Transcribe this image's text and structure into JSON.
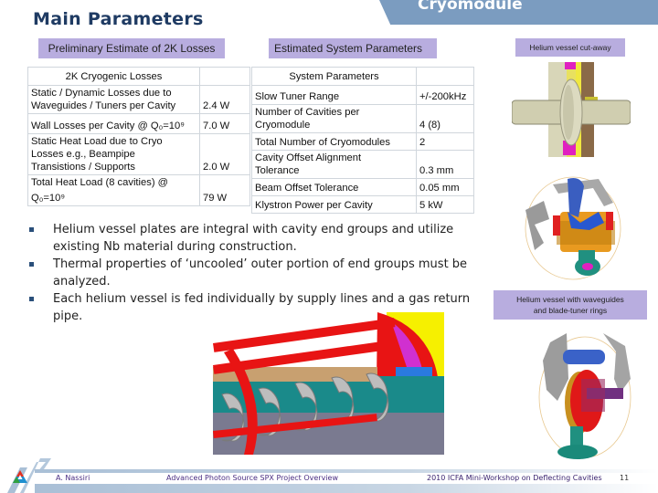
{
  "header": {
    "section_tab": "Cryomodule",
    "title": "Main Parameters"
  },
  "labels": {
    "losses_caption": "Preliminary Estimate of 2K Losses",
    "system_caption": "Estimated System Parameters",
    "image1_caption": "Helium vessel cut-away",
    "image2_caption_line1": "Helium vessel with waveguides",
    "image2_caption_line2": "and blade-tuner rings"
  },
  "losses_table": {
    "header": "2K Cryogenic Losses",
    "rows": [
      {
        "label_lines": [
          "Static / Dynamic Losses due to",
          "Waveguides / Tuners per Cavity"
        ],
        "value": "2.4 W"
      },
      {
        "label_lines": [
          "Wall Losses per Cavity @ Q₀=10⁹"
        ],
        "value": "7.0 W"
      },
      {
        "label_lines": [
          "Static Heat Load due to Cryo",
          "Losses e.g., Beampipe",
          "Transistions / Supports"
        ],
        "value": "2.0 W"
      },
      {
        "label_lines": [
          "Total Heat Load (8 cavities) @",
          "Q₀=10⁹"
        ],
        "value": "79 W"
      }
    ]
  },
  "system_table": {
    "header": "System Parameters",
    "rows": [
      {
        "label_lines": [
          "Slow Tuner Range"
        ],
        "value": "+/-200kHz"
      },
      {
        "label_lines": [
          "Number of Cavities per",
          "Cryomodule"
        ],
        "value": "4 (8)"
      },
      {
        "label_lines": [
          "Total Number of Cryomodules"
        ],
        "value": "2"
      },
      {
        "label_lines": [
          "Cavity Offset Alignment",
          "Tolerance"
        ],
        "value": "0.3 mm"
      },
      {
        "label_lines": [
          "Beam Offset Tolerance"
        ],
        "value": "0.05 mm"
      },
      {
        "label_lines": [
          "Klystron Power per Cavity"
        ],
        "value": "5 kW"
      }
    ]
  },
  "bullets": [
    "Helium vessel plates are integral with cavity end groups and utilize existing Nb material during construction.",
    "Thermal properties of ‘uncooled’ outer portion of end groups must be analyzed.",
    "Each helium vessel is fed individually by supply lines and a gas return pipe."
  ],
  "images": {
    "cutaway": "helium-vessel-cutaway-render",
    "waveguide": "helium-vessel-waveguides-render",
    "blade_tuner": "blade-tuner-ring-render",
    "cryomodule": "cryomodule-assembly-render"
  },
  "footer": {
    "author": "A. Nassiri",
    "project": "Advanced Photon Source SPX Project Overview",
    "workshop": "2010 ICFA Mini-Workshop on Deflecting Cavities",
    "page": "11"
  },
  "colors": {
    "title": "#1f3b63",
    "tab": "#7b9cc0",
    "caption_bg": "#b8addf",
    "footer_text": "#4b2e83"
  }
}
